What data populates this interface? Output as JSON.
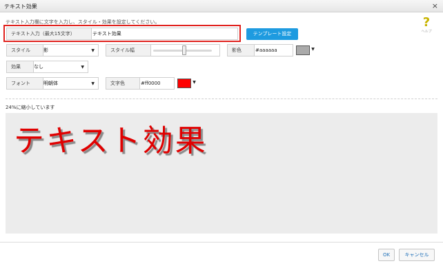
{
  "dialog": {
    "title": "テキスト効果",
    "instruction": "テキスト入力欄に文字を入力し、スタイル・効果を設定してください。",
    "help_label": "ヘルプ",
    "zoom_note": "24%に縮小しています"
  },
  "text_input": {
    "label": "テキスト入力（最大15文字）",
    "value": "テキスト効果"
  },
  "template_button": "テンプレート設定",
  "style": {
    "label": "スタイル",
    "value": "影"
  },
  "style_width": {
    "label": "スタイル幅",
    "level": 0.53
  },
  "shadow_color": {
    "label": "影色",
    "value": "#aaaaaa",
    "swatch": "#aaaaaa"
  },
  "effect": {
    "label": "効果",
    "value": "なし"
  },
  "font": {
    "label": "フォント",
    "value": "明朝体"
  },
  "text_color": {
    "label": "文字色",
    "value": "#ff0000",
    "swatch": "#ff0000"
  },
  "preview_text": "テキスト効果",
  "buttons": {
    "ok": "OK",
    "cancel": "キャンセル"
  }
}
